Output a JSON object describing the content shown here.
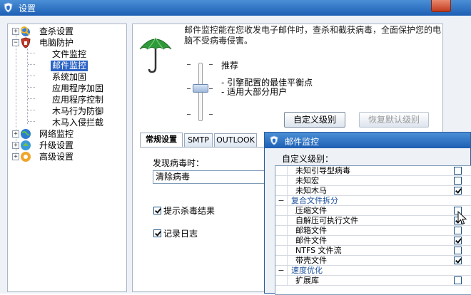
{
  "window": {
    "title": "设置"
  },
  "tree": {
    "items": [
      {
        "label": "查杀设置",
        "expander": "+",
        "icon": "search-scan-icon"
      },
      {
        "label": "电脑防护",
        "expander": "−",
        "icon": "shield-icon"
      },
      {
        "label": "文件监控"
      },
      {
        "label": "邮件监控",
        "selected": true
      },
      {
        "label": "系统加固"
      },
      {
        "label": "应用程序加固"
      },
      {
        "label": "应用程序控制"
      },
      {
        "label": "木马行为防御"
      },
      {
        "label": "木马入侵拦截"
      },
      {
        "label": "网络监控",
        "expander": "+",
        "icon": "network-globe-icon"
      },
      {
        "label": "升级设置",
        "expander": "+",
        "icon": "update-globe-icon"
      },
      {
        "label": "高级设置",
        "expander": "+",
        "icon": "gear-icon"
      }
    ]
  },
  "main": {
    "description": "邮件监控能在您收发电子邮件时，查杀和截获病毒，全面保护您的电脑不受病毒侵害。",
    "level": {
      "name": "推荐",
      "line1": "- 引擎配置的最佳平衡点",
      "line2": "- 适用大部分用户",
      "slider_position": 0.5
    },
    "buttons": {
      "custom": "自定义级别",
      "restore": "恢复默认级别"
    },
    "tabs": [
      {
        "label": "常规设置",
        "active": true
      },
      {
        "label": "SMTP",
        "active": false
      },
      {
        "label": "OUTLOOK",
        "active": false
      }
    ],
    "general": {
      "found_label": "发现病毒时：",
      "action_value": "清除病毒",
      "notify_label": "提示杀毒结果",
      "notify_checked": true,
      "log_label": "记录日志",
      "log_checked": true
    }
  },
  "dialog": {
    "title": "邮件监控",
    "section_label": "自定义级别：",
    "rows": [
      {
        "label": "未知引导型病毒",
        "indent": 2,
        "checked": false
      },
      {
        "label": "未知宏",
        "indent": 2,
        "checked": false
      },
      {
        "label": "未知木马",
        "indent": 2,
        "checked": true
      },
      {
        "label": "复合文件拆分",
        "indent": 1,
        "group": true,
        "expander": "−"
      },
      {
        "label": "压缩文件",
        "indent": 2,
        "checked": false
      },
      {
        "label": "自解压可执行文件",
        "indent": 2,
        "checked": true
      },
      {
        "label": "邮箱文件",
        "indent": 2,
        "checked": false
      },
      {
        "label": "邮件文件",
        "indent": 2,
        "checked": true
      },
      {
        "label": "NTFS 文件流",
        "indent": 2,
        "checked": false
      },
      {
        "label": "带壳文件",
        "indent": 2,
        "checked": true
      },
      {
        "label": "速度优化",
        "indent": 1,
        "group": true,
        "expander": "−"
      },
      {
        "label": "扩展库",
        "indent": 2,
        "checked": false
      }
    ]
  },
  "colors": {
    "titlebar": "#1d5fb4",
    "selection": "#2c63c5",
    "umbrella": "#2f9a3a"
  }
}
